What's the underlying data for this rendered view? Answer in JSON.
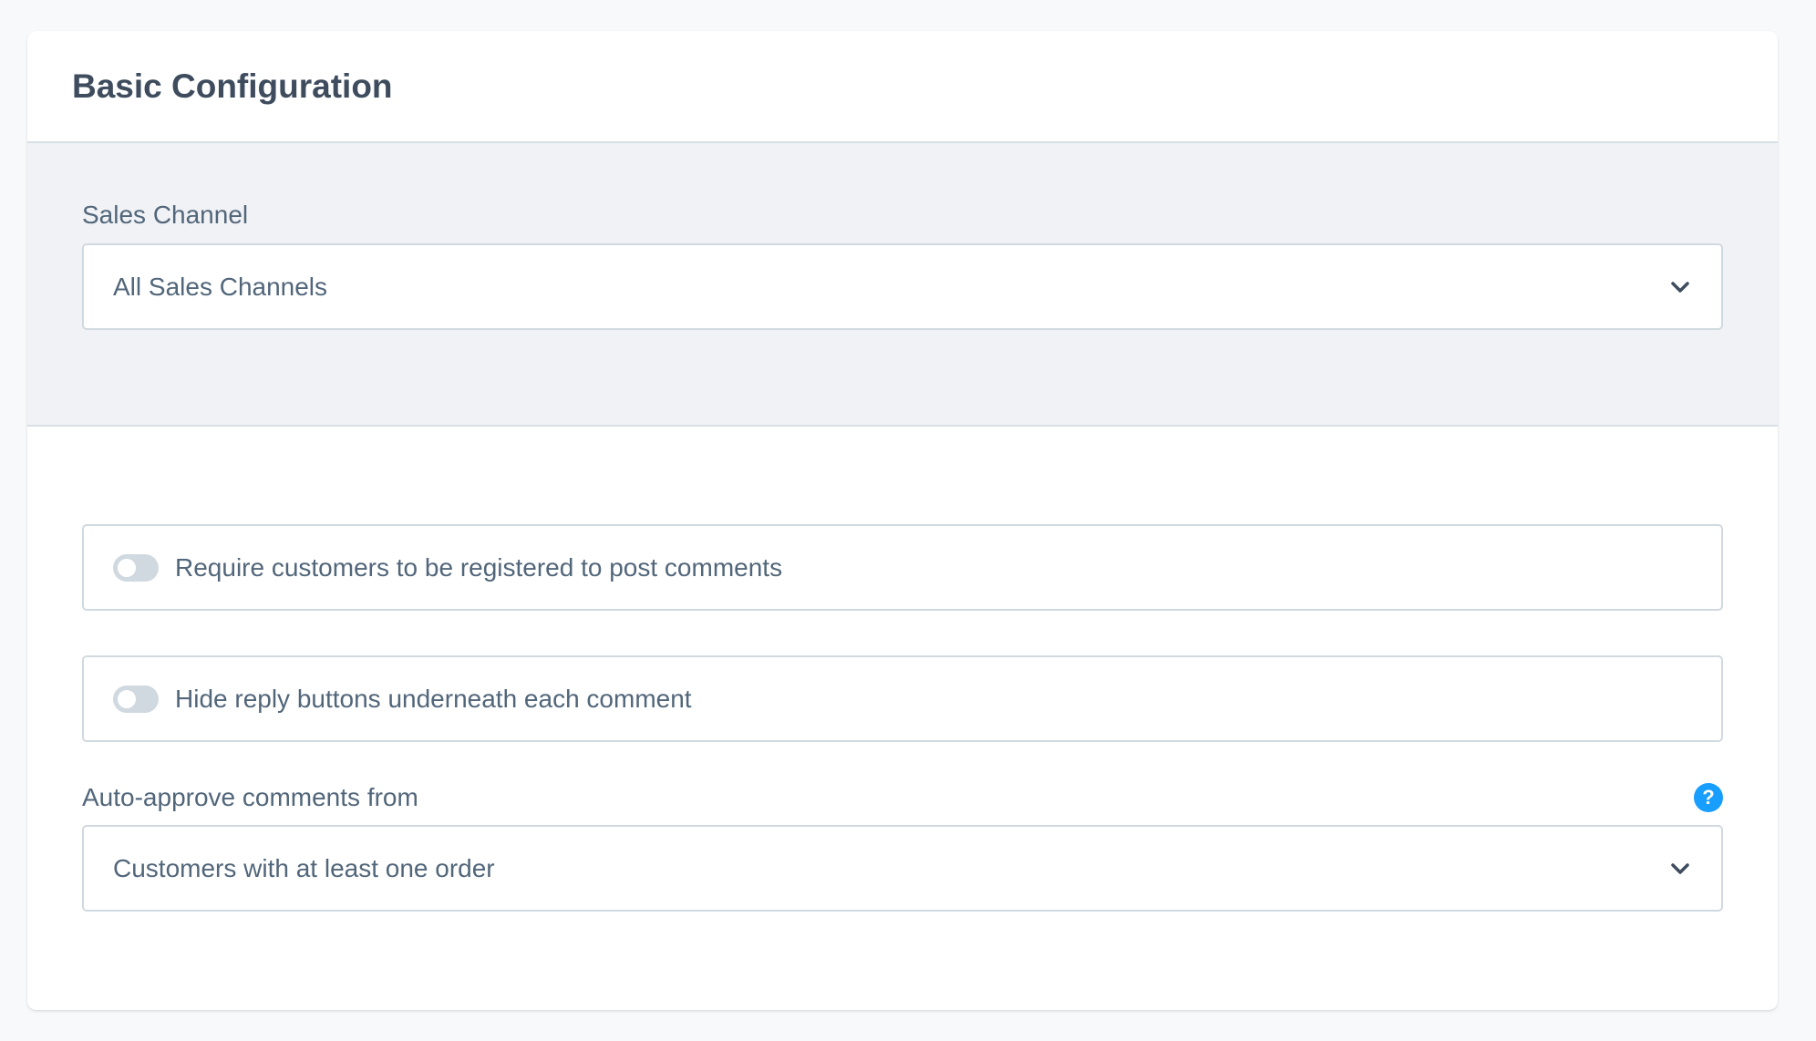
{
  "card": {
    "title": "Basic Configuration"
  },
  "sales_channel": {
    "label": "Sales Channel",
    "selected": "All Sales Channels",
    "icon": "chevron-down-icon"
  },
  "settings": {
    "require_registration": {
      "label": "Require customers to be registered to post comments",
      "enabled": false
    },
    "hide_reply_buttons": {
      "label": "Hide reply buttons underneath each comment",
      "enabled": false
    },
    "auto_approve": {
      "label": "Auto-approve comments from",
      "help_icon": "question-mark-icon",
      "help_glyph": "?",
      "selected": "Customers with at least one order",
      "icon": "chevron-down-icon"
    }
  },
  "colors": {
    "accent": "#189eff",
    "text": "#52667a",
    "title": "#3e4c5e",
    "border": "#d1d9e0",
    "scope_bg": "#f0f2f5"
  }
}
